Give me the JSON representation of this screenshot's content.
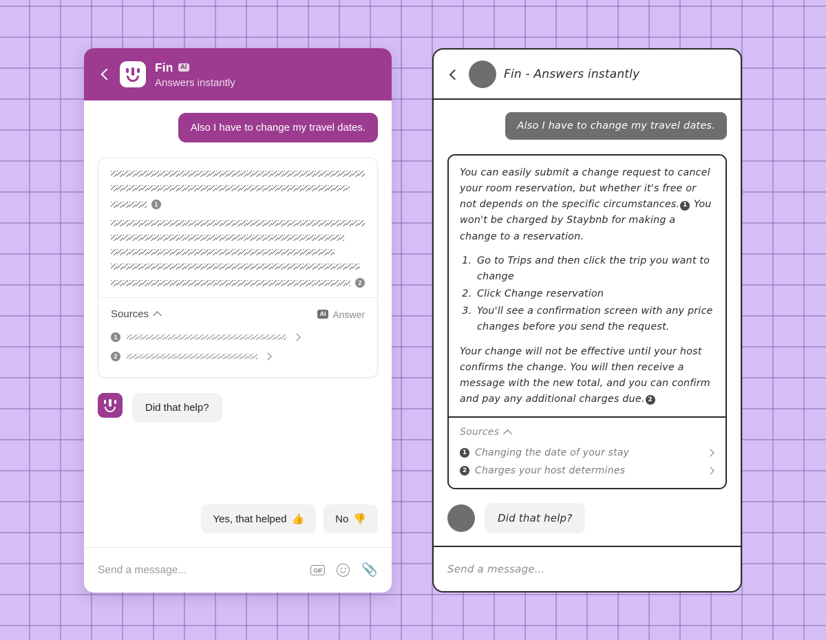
{
  "left_panel": {
    "header": {
      "back_icon": "back-chevron-icon",
      "logo_icon": "fin-logo-icon",
      "name": "Fin",
      "ai_badge": "AI",
      "subtitle": "Answers instantly"
    },
    "user_message": "Also I have to change my travel dates.",
    "answer_card": {
      "redacted": true,
      "paragraphs": [
        {
          "lines": [
            100,
            94
          ],
          "end_badge": "1",
          "last_line_width": 52
        },
        {
          "lines": [
            100,
            92,
            88,
            98
          ],
          "end_badge": "2",
          "last_line_width": 96
        }
      ],
      "sources_label": "Sources",
      "collapse_icon": "chevron-up-icon",
      "ai_tag_badge": "AI",
      "ai_tag_label": "Answer",
      "sources": [
        {
          "number": "1",
          "redacted": true
        },
        {
          "number": "2",
          "redacted": true
        }
      ]
    },
    "bot_prompt": "Did that help?",
    "feedback": [
      {
        "label": "Yes, that helped",
        "emoji": "👍"
      },
      {
        "label": "No",
        "emoji": "👎"
      }
    ],
    "composer": {
      "placeholder": "Send a message...",
      "icons": [
        "gif-icon",
        "emoji-icon",
        "attachment-icon"
      ],
      "gif_label": "GIF"
    }
  },
  "right_panel": {
    "header": {
      "back_icon": "back-chevron-icon",
      "avatar_icon": "avatar-placeholder",
      "title": "Fin - Answers instantly"
    },
    "user_message": "Also I have to change my travel dates.",
    "answer": {
      "para1_a": "You can easily submit a change request to cancel your room reservation, but whether it's free or not depends on the specific circumstances.",
      "para1_badge": "1",
      "para1_b": "You won't be charged by Staybnb for making a change to a reservation.",
      "steps": [
        "Go to Trips and then click the trip you want to change",
        "Click Change reservation",
        "You'll see a confirmation screen with any price changes before you send the request."
      ],
      "para2_a": "Your change will not be effective until your host confirms the change. You will then receive a message with the new total, and you can confirm and pay any additional charges due.",
      "para2_badge": "2",
      "sources_label": "Sources",
      "collapse_icon": "chevron-up-icon",
      "sources": [
        {
          "number": "1",
          "label": "Changing the date of your stay"
        },
        {
          "number": "2",
          "label": "Charges your host determines"
        }
      ]
    },
    "bot_prompt": "Did that help?",
    "composer": {
      "placeholder": "Send a message..."
    }
  },
  "colors": {
    "brand_purple": "#9c3b8f",
    "background": "#d6bdf5",
    "grid_line": "#785faa",
    "gray_avatar": "#6e6e6e",
    "bubble_gray": "#f2f2f2"
  }
}
